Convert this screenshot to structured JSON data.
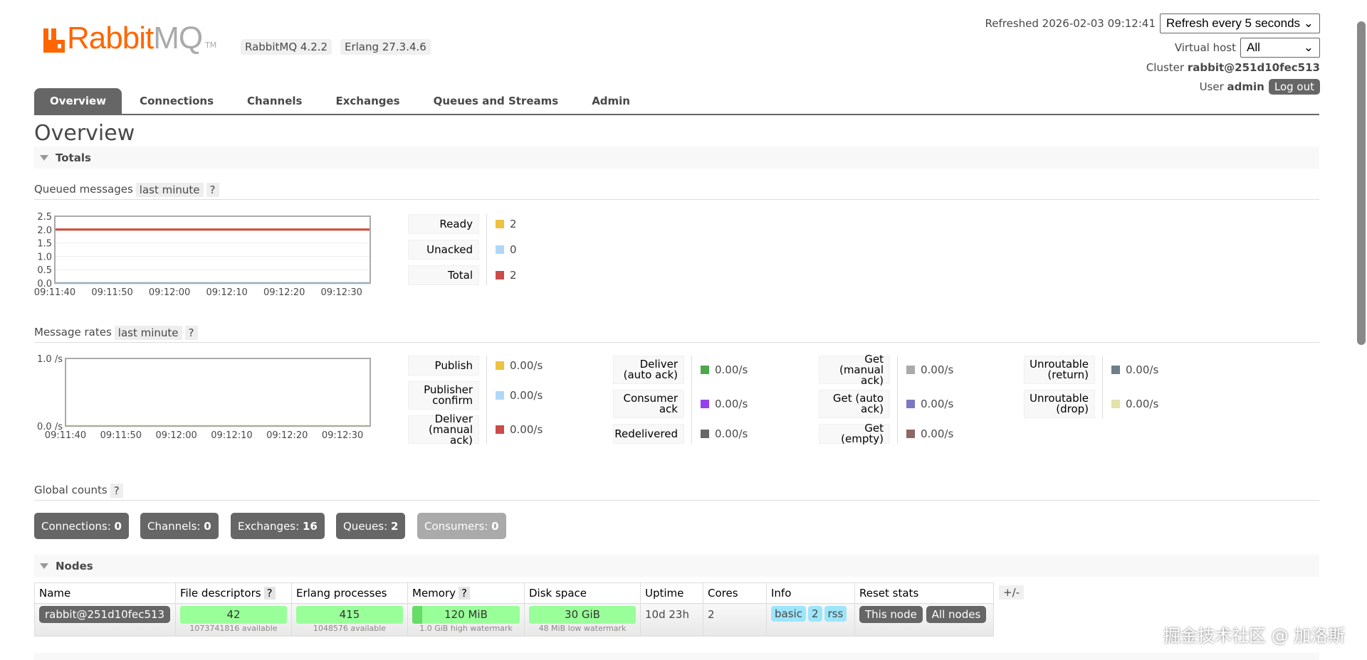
{
  "header": {
    "logo": "RabbitMQ",
    "logo_tm": "TM",
    "version": "RabbitMQ 4.2.2",
    "erlang": "Erlang 27.3.4.6",
    "refreshed_label": "Refreshed 2026-02-03 09:12:41",
    "refresh_select": "Refresh every 5 seconds",
    "vhost_label": "Virtual host",
    "vhost_select": "All",
    "cluster_label": "Cluster",
    "cluster_name": "rabbit@251d10fec513",
    "user_label": "User",
    "user_name": "admin",
    "logout": "Log out"
  },
  "tabs": [
    "Overview",
    "Connections",
    "Channels",
    "Exchanges",
    "Queues and Streams",
    "Admin"
  ],
  "page_title": "Overview",
  "totals": {
    "title": "Totals",
    "queued": {
      "label": "Queued messages",
      "range": "last minute",
      "help": "?",
      "legend": [
        {
          "label": "Ready",
          "value": "2",
          "color": "#edc240"
        },
        {
          "label": "Unacked",
          "value": "0",
          "color": "#afd8f8"
        },
        {
          "label": "Total",
          "value": "2",
          "color": "#cb4b4b"
        }
      ]
    },
    "rates": {
      "label": "Message rates",
      "range": "last minute",
      "help": "?",
      "columns": [
        [
          {
            "label": "Publish",
            "value": "0.00/s",
            "color": "#edc240"
          },
          {
            "label": "Publisher confirm",
            "value": "0.00/s",
            "color": "#afd8f8"
          },
          {
            "label": "Deliver (manual ack)",
            "value": "0.00/s",
            "color": "#cb4b4b"
          }
        ],
        [
          {
            "label": "Deliver (auto ack)",
            "value": "0.00/s",
            "color": "#4da74d"
          },
          {
            "label": "Consumer ack",
            "value": "0.00/s",
            "color": "#9440ed"
          },
          {
            "label": "Redelivered",
            "value": "0.00/s",
            "color": "#666666"
          }
        ],
        [
          {
            "label": "Get (manual ack)",
            "value": "0.00/s",
            "color": "#aaaaaa"
          },
          {
            "label": "Get (auto ack)",
            "value": "0.00/s",
            "color": "#7c79c3"
          },
          {
            "label": "Get (empty)",
            "value": "0.00/s",
            "color": "#8e6767"
          }
        ],
        [
          {
            "label": "Unroutable (return)",
            "value": "0.00/s",
            "color": "#6d7f88"
          },
          {
            "label": "Unroutable (drop)",
            "value": "0.00/s",
            "color": "#e2e3a9"
          }
        ]
      ]
    },
    "global": {
      "label": "Global counts",
      "help": "?",
      "items": [
        {
          "label": "Connections:",
          "value": "0"
        },
        {
          "label": "Channels:",
          "value": "0"
        },
        {
          "label": "Exchanges:",
          "value": "16"
        },
        {
          "label": "Queues:",
          "value": "2"
        },
        {
          "label": "Consumers:",
          "value": "0"
        }
      ]
    }
  },
  "nodes": {
    "title": "Nodes",
    "columns": [
      "Name",
      "File descriptors",
      "Erlang processes",
      "Memory",
      "Disk space",
      "Uptime",
      "Cores",
      "Info",
      "Reset stats"
    ],
    "help": "?",
    "toggle": "+/-",
    "row": {
      "name": "rabbit@251d10fec513",
      "fd": "42",
      "fd_sub": "1073741816 available",
      "procs": "415",
      "procs_sub": "1048576 available",
      "mem": "120 MiB",
      "mem_sub": "1.0 GiB high watermark",
      "disk": "30 GiB",
      "disk_sub": "48 MiB low watermark",
      "uptime": "10d 23h",
      "cores": "2",
      "info": [
        "basic",
        "2",
        "rss"
      ],
      "reset_this": "This node",
      "reset_all": "All nodes"
    }
  },
  "watermark": "掘金技术社区 @ 加洛斯",
  "chart_data": [
    {
      "type": "line",
      "title": "Queued messages",
      "ylim": [
        0,
        2.5
      ],
      "yticks": [
        "0.0",
        "0.5",
        "1.0",
        "1.5",
        "2.0",
        "2.5"
      ],
      "xlim": [
        0,
        55
      ],
      "xticks": [
        "09:11:40",
        "09:11:50",
        "09:12:00",
        "09:12:10",
        "09:12:20",
        "09:12:30"
      ],
      "series": [
        {
          "name": "Ready",
          "color": "#edc240",
          "values": [
            2,
            2
          ]
        },
        {
          "name": "Unacked",
          "color": "#afd8f8",
          "values": [
            0,
            0
          ]
        },
        {
          "name": "Total",
          "color": "#cb4b4b",
          "values": [
            2,
            2
          ]
        }
      ]
    },
    {
      "type": "line",
      "title": "Message rates",
      "ylim": [
        0,
        1
      ],
      "yticks": [
        "0.0 /s",
        "1.0 /s"
      ],
      "xlim": [
        0,
        55
      ],
      "xticks": [
        "09:11:40",
        "09:11:50",
        "09:12:00",
        "09:12:10",
        "09:12:20",
        "09:12:30"
      ],
      "series": [
        {
          "name": "Publish",
          "color": "#edc240",
          "values": [
            0,
            0
          ]
        },
        {
          "name": "Unroutable (drop)",
          "color": "#e2e3a9",
          "values": [
            0,
            0
          ]
        }
      ]
    }
  ]
}
